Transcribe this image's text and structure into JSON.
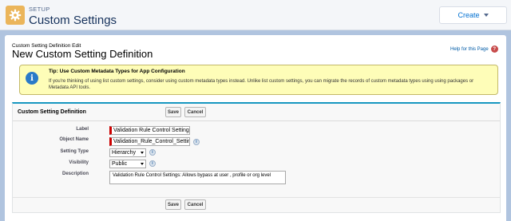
{
  "header": {
    "eyebrow": "SETUP",
    "title": "Custom Settings",
    "icon": "gear-icon",
    "create_label": "Create"
  },
  "page": {
    "breadcrumb": "Custom Setting Definition Edit",
    "title": "New Custom Setting Definition",
    "help_label": "Help for this Page",
    "help_icon": "help-icon"
  },
  "tip": {
    "title": "Tip: Use Custom Metadata Types for App Configuration",
    "body": "If you're thinking of using list custom settings, consider using custom metadata types instead. Unlike list custom settings, you can migrate the records of custom metadata types using using packages or Metadata API tools.",
    "icon": "info-icon"
  },
  "form": {
    "section_title": "Custom Setting Definition",
    "save_label": "Save",
    "cancel_label": "Cancel",
    "fields": {
      "label": {
        "label": "Label",
        "value": "Validation Rule Control Setting"
      },
      "object_name": {
        "label": "Object Name",
        "value": "Validation_Rule_Control_Setting",
        "info_icon": "i"
      },
      "setting_type": {
        "label": "Setting Type",
        "value": "Hierarchy",
        "info_icon": "i"
      },
      "visibility": {
        "label": "Visibility",
        "value": "Public",
        "info_icon": "i"
      },
      "description": {
        "label": "Description",
        "value": "Validation Rule Control Settings: Allows bypass at user , profile or org level"
      }
    }
  },
  "colors": {
    "page_bg": "#b0c4df",
    "brand_icon": "#ebb55a",
    "link_blue": "#0070d2",
    "section_accent": "#1797c0",
    "tip_bg": "#fefdb8",
    "required_bar": "#cc0000"
  }
}
